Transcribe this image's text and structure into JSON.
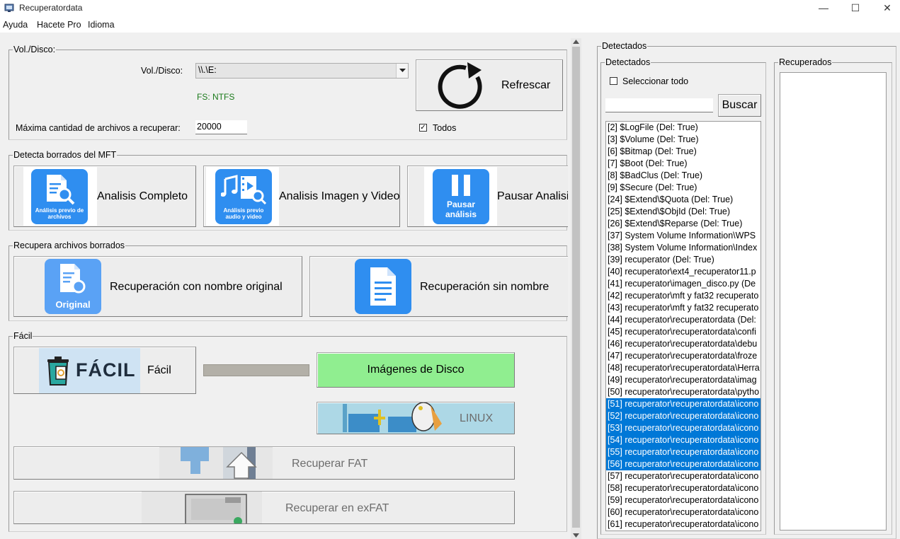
{
  "window": {
    "title": "Recuperatordata",
    "minimize_glyph": "—",
    "maximize_glyph": "☐",
    "close_glyph": "✕"
  },
  "menu": [
    "Ayuda",
    "Hacete Pro",
    "Idioma"
  ],
  "volume_group": {
    "title": "Vol./Disco:",
    "vol_label": "Vol./Disco:",
    "vol_value": "\\\\.\\E:",
    "fs_text": "FS: NTFS",
    "max_label": "Máxima cantidad de archivos a recuperar:",
    "max_value": "20000",
    "todos_label": "Todos",
    "todos_checked": "✓",
    "refresh_label": "Refrescar"
  },
  "mft_group": {
    "title": "Detecta borrados del MFT",
    "full_label": "Analisis Completo",
    "full_icon_caption": "Análisis previo de archivos",
    "media_label": "Analisis Imagen y Video",
    "media_icon_caption": "Análisis previo audio y video",
    "pause_label": "Pausar Analisis",
    "pause_icon_caption": "Pausar análisis"
  },
  "recover_group": {
    "title": "Recupera archivos borrados",
    "original_label": "Recuperación con nombre original",
    "original_icon_caption": "Original",
    "noname_label": "Recuperación sin nombre"
  },
  "easy_group": {
    "title": "Fácil",
    "easy_label": "Fácil",
    "easy_icon_caption": "FÁCIL",
    "disk_images_label": "Imágenes de Disco",
    "linux_label": "LINUX",
    "fat_label": "Recuperar FAT",
    "exfat_label": "Recuperar en exFAT"
  },
  "detected_outer": {
    "title": "Detectados"
  },
  "detected": {
    "title": "Detectados",
    "select_all_label": "Seleccionar todo",
    "search_placeholder": "",
    "search_button": "Buscar",
    "items": [
      "[2] $LogFile (Del: True)",
      "[3] $Volume (Del: True)",
      "[6] $Bitmap (Del: True)",
      "[7] $Boot (Del: True)",
      "[8] $BadClus (Del: True)",
      "[9] $Secure (Del: True)",
      "[24] $Extend\\$Quota (Del: True)",
      "[25] $Extend\\$ObjId (Del: True)",
      "[26] $Extend\\$Reparse (Del: True)",
      "[37] System Volume Information\\WPS",
      "[38] System Volume Information\\Index",
      "[39] recuperator (Del: True)",
      "[40] recuperator\\ext4_recuperator11.p",
      "[41] recuperator\\imagen_disco.py (De",
      "[42] recuperator\\mft y fat32 recuperato",
      "[43] recuperator\\mft y fat32 recuperato",
      "[44] recuperator\\recuperatordata (Del:",
      "[45] recuperator\\recuperatordata\\confi",
      "[46] recuperator\\recuperatordata\\debu",
      "[47] recuperator\\recuperatordata\\froze",
      "[48] recuperator\\recuperatordata\\Herra",
      "[49] recuperator\\recuperatordata\\imag",
      "[50] recuperator\\recuperatordata\\pytho",
      "[51] recuperator\\recuperatordata\\icono",
      "[52] recuperator\\recuperatordata\\icono",
      "[53] recuperator\\recuperatordata\\icono",
      "[54] recuperator\\recuperatordata\\icono",
      "[55] recuperator\\recuperatordata\\icono",
      "[56] recuperator\\recuperatordata\\icono",
      "[57] recuperator\\recuperatordata\\icono",
      "[58] recuperator\\recuperatordata\\icono",
      "[59] recuperator\\recuperatordata\\icono",
      "[60] recuperator\\recuperatordata\\icono",
      "[61] recuperator\\recuperatordata\\icono"
    ],
    "selected_range": [
      23,
      28
    ]
  },
  "recovered": {
    "title": "Recuperados",
    "items": []
  },
  "colors": {
    "accent": "#2f8ef0",
    "selection": "#0078d7",
    "fs_text": "#1a7a1a",
    "disk_images_bg": "#90ee90",
    "linux_bg": "#add8e6"
  }
}
